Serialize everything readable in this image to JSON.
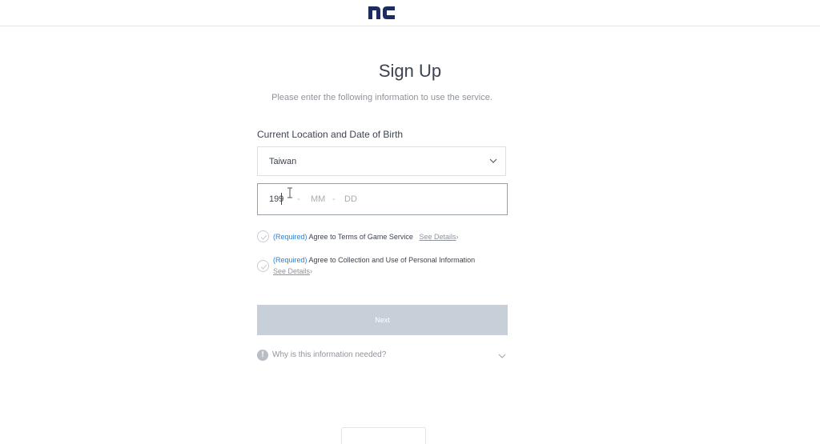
{
  "header": {
    "logo_text": "nc"
  },
  "page": {
    "title": "Sign Up",
    "subtitle": "Please enter the following information to use the service."
  },
  "form": {
    "section_label": "Current Location and Date of Birth",
    "country": {
      "selected": "Taiwan"
    },
    "dob": {
      "year_value": "199",
      "separator": "-",
      "month_placeholder": "MM",
      "day_placeholder": "DD"
    },
    "agreements": [
      {
        "required": "(Required)",
        "label": "Agree to Terms of Game Service",
        "details": "See Details",
        "arrow": "›"
      },
      {
        "required": "(Required)",
        "label": "Agree to Collection and Use of Personal Information",
        "details": "See Details",
        "arrow": "›"
      }
    ],
    "next_label": "Next",
    "why": {
      "icon": "!",
      "label": "Why is this information needed?"
    }
  },
  "colors": {
    "accent_blue": "#2f7fd1",
    "logo_navy": "#1d2c5e",
    "disabled_button": "#c7d0d9"
  }
}
